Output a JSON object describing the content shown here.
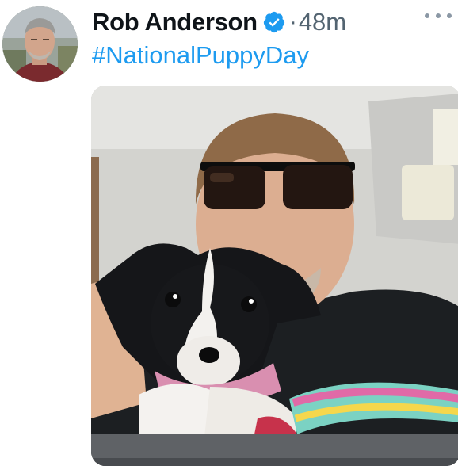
{
  "tweet": {
    "author_name": "Rob Anderson",
    "separator": "·",
    "time": "48m",
    "text": "#NationalPuppyDay",
    "verified_color": "#1d9bf0",
    "hashtag_color": "#1d9bf0"
  },
  "icons": {
    "verified": "verified-badge-icon",
    "more": "more-options-icon"
  }
}
